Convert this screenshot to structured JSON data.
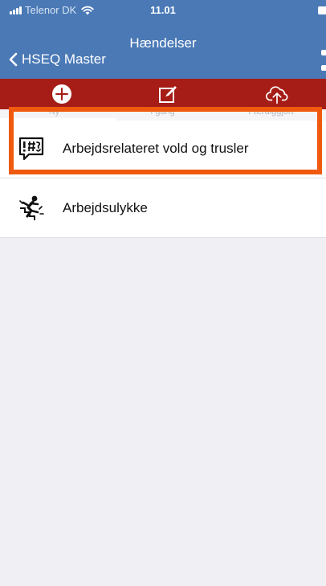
{
  "status_bar": {
    "carrier": "Telenor DK",
    "time": "11.01"
  },
  "nav": {
    "title": "Hændelser",
    "back_label": "HSEQ Master"
  },
  "toolbar": {
    "icons": [
      "plus-circle-icon",
      "edit-icon",
      "cloud-upload-icon"
    ]
  },
  "segments": [
    "Ny",
    "I gang",
    "Færdiggjort"
  ],
  "list": {
    "items": [
      {
        "label": "Arbejdsrelateret vold og trusler",
        "icon": "speech-threat-icon"
      },
      {
        "label": "Arbejdsulykke",
        "icon": "falling-person-icon"
      }
    ]
  },
  "colors": {
    "nav_blue": "#4a79b6",
    "toolbar_red": "#a61c16",
    "highlight_orange": "#f05a0f",
    "background": "#efeff4"
  }
}
